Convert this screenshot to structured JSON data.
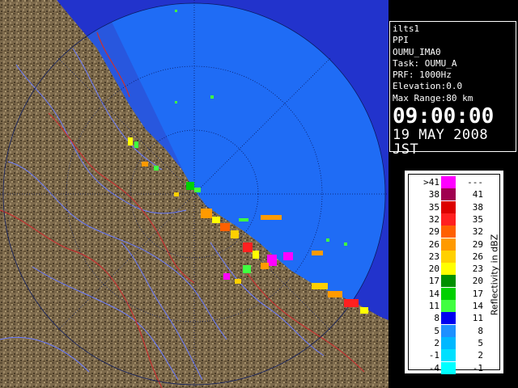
{
  "info": {
    "station": "ilts1",
    "scan_type": "PPI",
    "site_id": "OUMU_IMA0",
    "task": "Task: OUMU_A",
    "prf": "PRF: 1000Hz",
    "elevation": "Elevation:0.0",
    "max_range": "Max Range:80 km",
    "time": "09:00:00",
    "date": "19 MAY 2008 JST"
  },
  "legend": {
    "unit_label": "Reflectivity in dBZ",
    "rows": [
      {
        "lo": ">41",
        "hi": "---",
        "color": "#ff00ff"
      },
      {
        "lo": "38",
        "hi": "41",
        "color": "#a00050"
      },
      {
        "lo": "35",
        "hi": "38",
        "color": "#dc0000"
      },
      {
        "lo": "32",
        "hi": "35",
        "color": "#ff2020"
      },
      {
        "lo": "29",
        "hi": "32",
        "color": "#ff6000"
      },
      {
        "lo": "26",
        "hi": "29",
        "color": "#ff9a00"
      },
      {
        "lo": "23",
        "hi": "26",
        "color": "#ffd000"
      },
      {
        "lo": "20",
        "hi": "23",
        "color": "#ffff00"
      },
      {
        "lo": "17",
        "hi": "20",
        "color": "#009000"
      },
      {
        "lo": "14",
        "hi": "17",
        "color": "#00d000"
      },
      {
        "lo": "11",
        "hi": "14",
        "color": "#40ff40"
      },
      {
        "lo": "8",
        "hi": "11",
        "color": "#0000f0"
      },
      {
        "lo": "5",
        "hi": "8",
        "color": "#1e90ff"
      },
      {
        "lo": "2",
        "hi": "5",
        "color": "#00b8ff"
      },
      {
        "lo": "-1",
        "hi": "2",
        "color": "#00e0ff"
      },
      {
        "lo": "-4",
        "hi": "-1",
        "color": "#00ffff"
      }
    ]
  },
  "colors": {
    "sea_outer": "#2233cc",
    "sea_inner": "#1f6cf5",
    "land": "#7a6648",
    "rivers": "#6a7cff",
    "boundaries": "#c83232"
  }
}
